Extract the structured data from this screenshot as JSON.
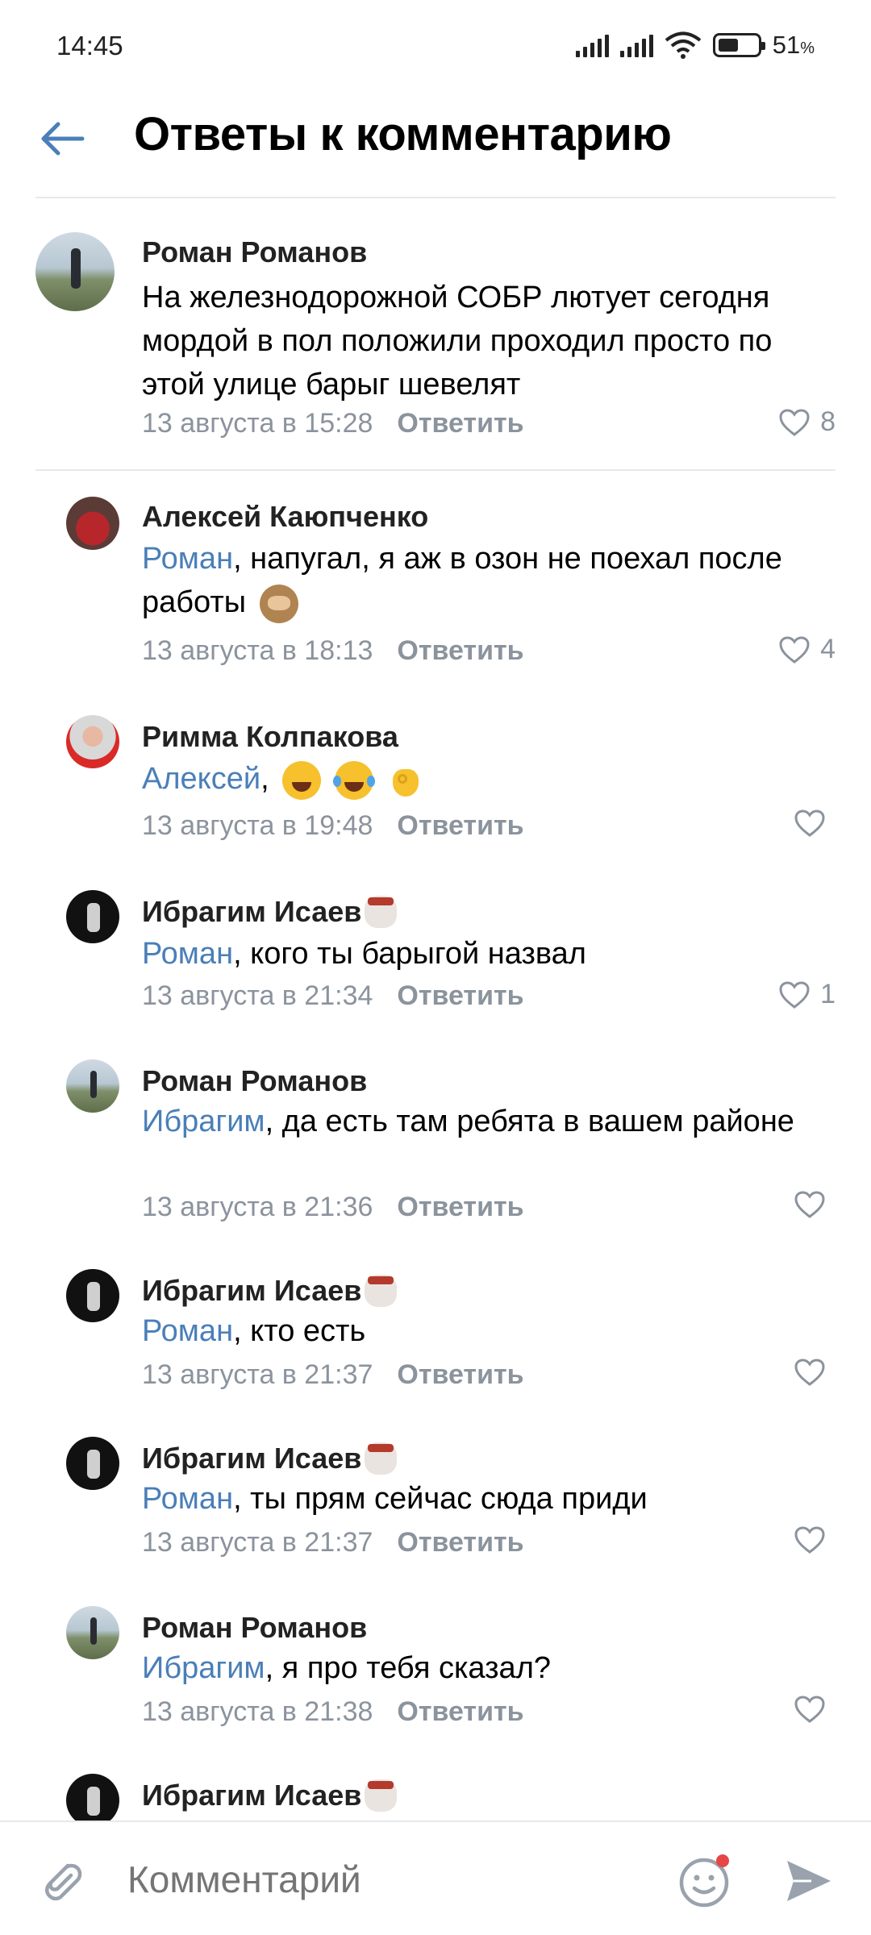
{
  "status_bar": {
    "time": "14:45",
    "battery": "51",
    "battery_unit": "%",
    "battery_level": 0.51
  },
  "header": {
    "title": "Ответы к комментарию",
    "back_icon": "arrow-left-icon"
  },
  "accent_color": "#4a7fb8",
  "meta_color": "#8b939d",
  "root_comment": {
    "author": "Роман Романов",
    "text": "На железнодорожной СОБР лютует сегодня мордой в пол положили проходил просто по этой улице барыг шевелят",
    "date": "13 августа в 15:28",
    "reply_label": "Ответить",
    "likes": "8"
  },
  "replies": [
    {
      "author": "Алексей Каюпченко",
      "mention": "Роман",
      "text": ", напугал, я аж в озон не поехал после работы",
      "date": "13 августа в 18:13",
      "reply_label": "Ответить",
      "likes": "4"
    },
    {
      "author": "Римма Колпакова",
      "mention": "Алексей",
      "text": ",",
      "date": "13 августа в 19:48",
      "reply_label": "Ответить",
      "likes": ""
    },
    {
      "author": "Ибрагим Исаев",
      "mention": "Роман",
      "text": ", кого ты барыгой назвал",
      "date": "13 августа в 21:34",
      "reply_label": "Ответить",
      "likes": "1"
    },
    {
      "author": "Роман Романов",
      "mention": "Ибрагим",
      "text": ", да есть там ребята в вашем районе",
      "date": "13 августа в 21:36",
      "reply_label": "Ответить",
      "likes": ""
    },
    {
      "author": "Ибрагим Исаев",
      "mention": "Роман",
      "text": ", кто есть",
      "date": "13 августа в 21:37",
      "reply_label": "Ответить",
      "likes": ""
    },
    {
      "author": "Ибрагим Исаев",
      "mention": "Роман",
      "text": ", ты прям сейчас сюда приди",
      "date": "13 августа в 21:37",
      "reply_label": "Ответить",
      "likes": ""
    },
    {
      "author": "Роман Романов",
      "mention": "Ибрагим",
      "text": ", я про тебя сказал?",
      "date": "13 августа в 21:38",
      "reply_label": "Ответить",
      "likes": ""
    },
    {
      "author": "Ибрагим Исаев"
    }
  ],
  "composer": {
    "placeholder": "Комментарий"
  }
}
